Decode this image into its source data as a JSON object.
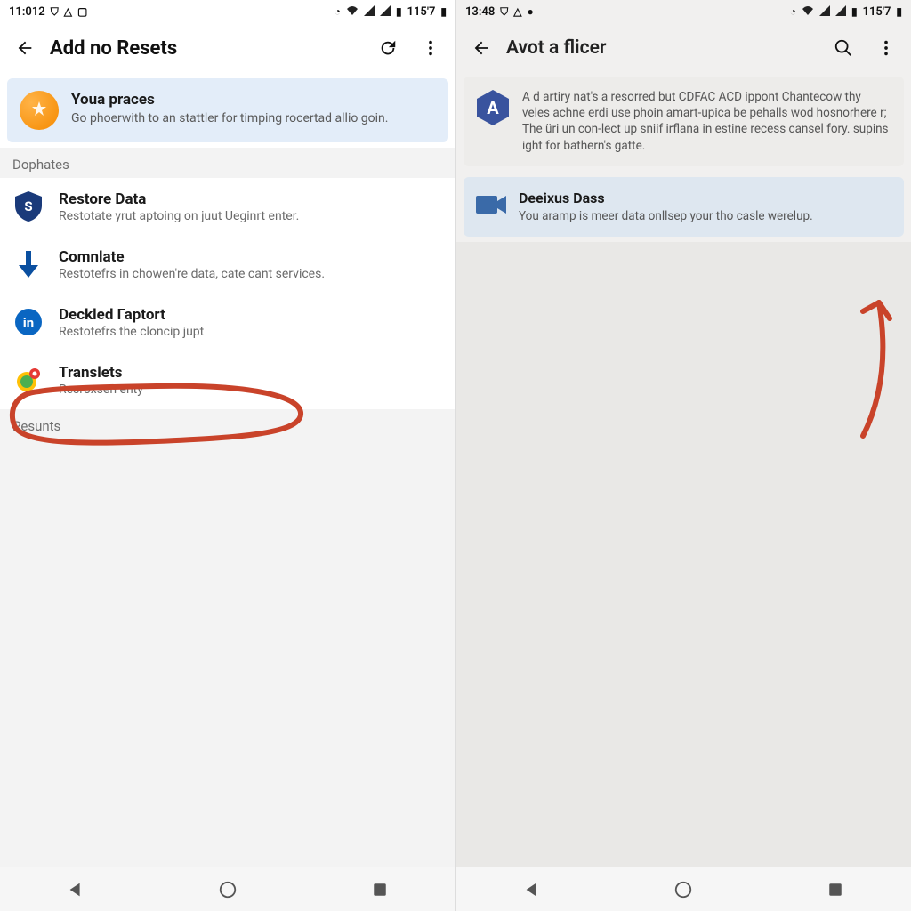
{
  "left": {
    "status": {
      "time": "11:012",
      "right": "115'7"
    },
    "appbar": {
      "title": "Add no Resets"
    },
    "hero": {
      "title": "Youa praces",
      "desc": "Go phoerwith to an stattler for timping rocertad allio goin."
    },
    "section1": "Dophates",
    "items": [
      {
        "title": "Restore Data",
        "desc": "Restotate yrut aptoing on juut Ueginrt enter."
      },
      {
        "title": "Comnlate",
        "desc": "Restotefrs in chowen're data, cate cant services."
      },
      {
        "title": "Deckled Гарtort",
        "desc": "Restotefrs the cloncip jupt"
      },
      {
        "title": "Translets",
        "desc": "Resroxsen enty"
      }
    ],
    "section2": "Pesunts"
  },
  "right": {
    "status": {
      "time": "13:48",
      "right": "115'7"
    },
    "appbar": {
      "title": "Avot a flicer"
    },
    "info": {
      "desc": "A d artiry nat's a resorred but CDFAC ACD ippont Chantecow thy veles achne erdi use phoin amart-upica be pehalls wod hosnorhere r; The üri un con-lect up sniif irflana in estine recess cansel fory. supins ight for bathern's gatte."
    },
    "card": {
      "title": "Deeixus Dass",
      "desc": "You aramp is meer data onllsep your tho casle werelup."
    }
  }
}
